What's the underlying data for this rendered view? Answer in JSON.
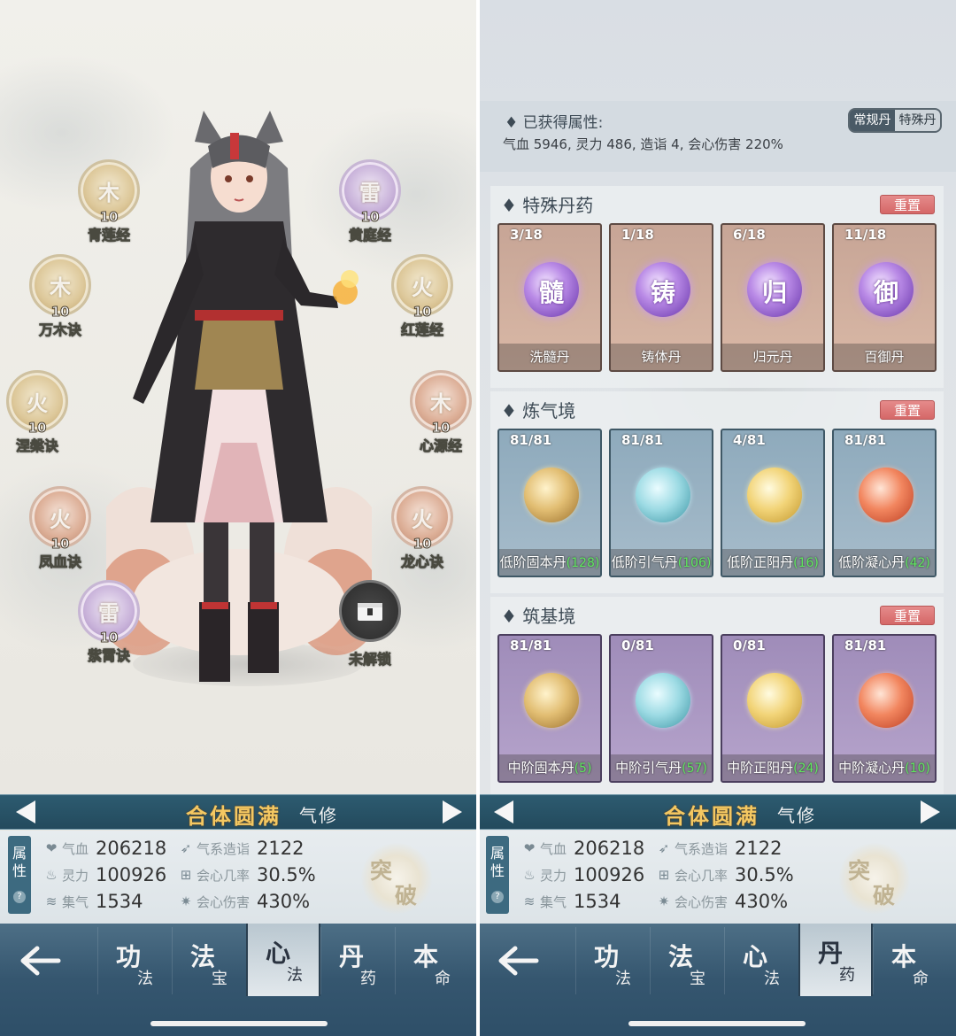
{
  "left": {
    "skills": [
      {
        "name": "青莲经",
        "level": "10",
        "glyph": "木",
        "style": "gold"
      },
      {
        "name": "万木诀",
        "level": "10",
        "glyph": "木",
        "style": "gold"
      },
      {
        "name": "涅槃诀",
        "level": "10",
        "glyph": "火",
        "style": "gold"
      },
      {
        "name": "凤血诀",
        "level": "10",
        "glyph": "火",
        "style": "rose"
      },
      {
        "name": "紫霄诀",
        "level": "10",
        "glyph": "雷",
        "style": "purple"
      },
      {
        "name": "黄庭经",
        "level": "10",
        "glyph": "雷",
        "style": "purple"
      },
      {
        "name": "红莲经",
        "level": "10",
        "glyph": "火",
        "style": "gold"
      },
      {
        "name": "心源经",
        "level": "10",
        "glyph": "木",
        "style": "rose"
      },
      {
        "name": "龙心诀",
        "level": "10",
        "glyph": "火",
        "style": "rose"
      }
    ],
    "locked_label": "未解锁"
  },
  "bottom": {
    "realm_title": "合体圆满",
    "realm_type": "气修",
    "attr_tag": "属性",
    "attr_help": "?",
    "stats": [
      {
        "icon": "heart-icon",
        "glyph": "❤",
        "label": "气血",
        "value": "206218"
      },
      {
        "icon": "flame-icon",
        "glyph": "♨",
        "label": "灵力",
        "value": "100926"
      },
      {
        "icon": "swirl-icon",
        "glyph": "≋",
        "label": "集气",
        "value": "1534"
      },
      {
        "icon": "wind-icon",
        "glyph": "➶",
        "label": "气系造诣",
        "value": "2122"
      },
      {
        "icon": "crit-rate-icon",
        "glyph": "⊞",
        "label": "会心几率",
        "value": "30.5%"
      },
      {
        "icon": "crit-damage-icon",
        "glyph": "✷",
        "label": "会心伤害",
        "value": "430%"
      }
    ],
    "breakthrough": [
      "突",
      "破"
    ]
  },
  "nav_left": {
    "tabs": [
      {
        "main": "功",
        "sub": "法"
      },
      {
        "main": "法",
        "sub": "宝"
      },
      {
        "main": "心",
        "sub": "法"
      },
      {
        "main": "丹",
        "sub": "药"
      },
      {
        "main": "本",
        "sub": "命"
      }
    ],
    "active_index": 2
  },
  "nav_right": {
    "tabs": [
      {
        "main": "功",
        "sub": "法"
      },
      {
        "main": "法",
        "sub": "宝"
      },
      {
        "main": "心",
        "sub": "法"
      },
      {
        "main": "丹",
        "sub": "药"
      },
      {
        "main": "本",
        "sub": "命"
      }
    ],
    "active_index": 3
  },
  "right": {
    "attr_heading": "已获得属性:",
    "attr_values": "气血 5946, 灵力 486, 造诣 4, 会心伤害 220%",
    "toggle": [
      "常规丹",
      "特殊丹"
    ],
    "sections": [
      {
        "title": "特殊丹药",
        "reset": "重置",
        "style": "special",
        "pills": [
          {
            "count": "3/18",
            "name": "洗髓丹",
            "bonus": "",
            "glyph": "髓",
            "orb": "purple"
          },
          {
            "count": "1/18",
            "name": "铸体丹",
            "bonus": "",
            "glyph": "铸",
            "orb": "purple"
          },
          {
            "count": "6/18",
            "name": "归元丹",
            "bonus": "",
            "glyph": "归",
            "orb": "purple"
          },
          {
            "count": "11/18",
            "name": "百御丹",
            "bonus": "",
            "glyph": "御",
            "orb": "purple"
          }
        ]
      },
      {
        "title": "炼气境",
        "reset": "重置",
        "style": "qi",
        "pills": [
          {
            "count": "81/81",
            "name": "低阶固本丹",
            "bonus": "(128)",
            "glyph": "",
            "orb": "gold"
          },
          {
            "count": "81/81",
            "name": "低阶引气丹",
            "bonus": "(106)",
            "glyph": "",
            "orb": "teal"
          },
          {
            "count": "4/81",
            "name": "低阶正阳丹",
            "bonus": "(16)",
            "glyph": "",
            "orb": "yellow"
          },
          {
            "count": "81/81",
            "name": "低阶凝心丹",
            "bonus": "(42)",
            "glyph": "",
            "orb": "red"
          }
        ]
      },
      {
        "title": "筑基境",
        "reset": "重置",
        "style": "zhuji",
        "pills": [
          {
            "count": "81/81",
            "name": "中阶固本丹",
            "bonus": "(5)",
            "glyph": "",
            "orb": "gold"
          },
          {
            "count": "0/81",
            "name": "中阶引气丹",
            "bonus": "(57)",
            "glyph": "",
            "orb": "teal"
          },
          {
            "count": "0/81",
            "name": "中阶正阳丹",
            "bonus": "(24)",
            "glyph": "",
            "orb": "yellow"
          },
          {
            "count": "81/81",
            "name": "中阶凝心丹",
            "bonus": "(10)",
            "glyph": "",
            "orb": "red"
          }
        ]
      }
    ]
  }
}
